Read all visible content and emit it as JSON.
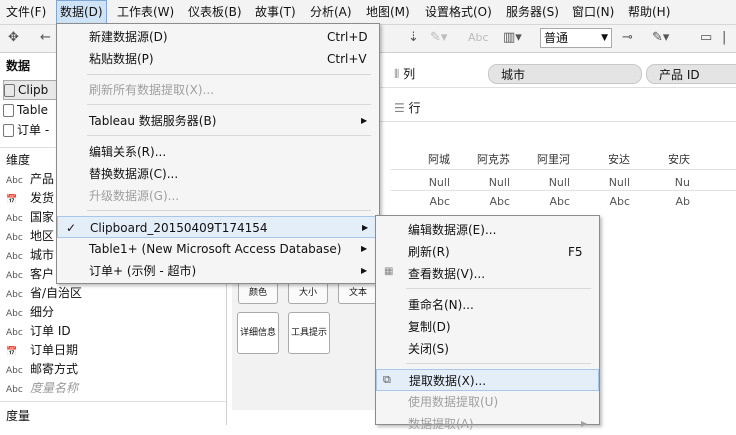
{
  "menubar": [
    "文件(F)",
    "数据(D)",
    "工作表(W)",
    "仪表板(B)",
    "故事(T)",
    "分析(A)",
    "地图(M)",
    "设置格式(O)",
    "服务器(S)",
    "窗口(N)",
    "帮助(H)"
  ],
  "toolbar": {
    "fit_value": "普通",
    "abc_label": "Abc"
  },
  "left_panel": {
    "data_title": "数据",
    "data_sources": [
      "Clipb",
      "Table",
      "订单 -"
    ],
    "dimensions_title": "维度",
    "dimensions": [
      {
        "type": "Abc",
        "name": "产品"
      },
      {
        "type": "📅",
        "name": "发货"
      },
      {
        "type": "Abc",
        "name": "国家"
      },
      {
        "type": "Abc",
        "name": "地区"
      },
      {
        "type": "Abc",
        "name": "城市"
      },
      {
        "type": "Abc",
        "name": "客户"
      },
      {
        "type": "Abc",
        "name": "省/自治区"
      },
      {
        "type": "Abc",
        "name": "细分"
      },
      {
        "type": "Abc",
        "name": "订单 ID"
      },
      {
        "type": "📅",
        "name": "订单日期"
      },
      {
        "type": "Abc",
        "name": "邮寄方式"
      },
      {
        "type": "Abc",
        "name": "度量名称"
      }
    ],
    "measures_title": "度量"
  },
  "shelves": {
    "columns_label": "列",
    "rows_label": "行",
    "column_pills": [
      "城市",
      "产品 ID"
    ]
  },
  "table": {
    "headers": [
      "阿城",
      "阿克苏",
      "阿里河",
      "安达",
      "安庆"
    ],
    "row1": [
      "Null",
      "Null",
      "Null",
      "Null",
      "Nu"
    ],
    "row2": [
      "Abc",
      "Abc",
      "Abc",
      "Abc",
      "Ab"
    ]
  },
  "marks": {
    "color": "颜色",
    "size": "大小",
    "text": "文本",
    "detail": "详细信息",
    "tooltip": "工具提示"
  },
  "data_menu": [
    {
      "label": "新建数据源(D)",
      "shortcut": "Ctrl+D",
      "disabled": false
    },
    {
      "label": "粘贴数据(P)",
      "shortcut": "Ctrl+V",
      "disabled": false
    },
    {
      "label": "刷新所有数据提取(X)...",
      "shortcut": "",
      "disabled": true
    },
    {
      "label": "Tableau 数据服务器(B)",
      "shortcut": "",
      "disabled": false,
      "submenu": true
    },
    {
      "label": "编辑关系(R)...",
      "shortcut": "",
      "disabled": false
    },
    {
      "label": "替换数据源(C)...",
      "shortcut": "",
      "disabled": false
    },
    {
      "label": "升级数据源(G)...",
      "shortcut": "",
      "disabled": true
    },
    {
      "label": "Clipboard_20150409T174154",
      "shortcut": "",
      "disabled": false,
      "submenu": true,
      "checked": true,
      "highlight": true
    },
    {
      "label": "Table1+ (New Microsoft Access Database)",
      "shortcut": "",
      "disabled": false,
      "submenu": true
    },
    {
      "label": "订单+ (示例 - 超市)",
      "shortcut": "",
      "disabled": false,
      "submenu": true
    }
  ],
  "sub_menu": [
    {
      "label": "编辑数据源(E)...",
      "shortcut": "",
      "disabled": false
    },
    {
      "label": "刷新(R)",
      "shortcut": "F5",
      "disabled": false
    },
    {
      "label": "查看数据(V)...",
      "shortcut": "",
      "disabled": false
    },
    {
      "label": "重命名(N)...",
      "shortcut": "",
      "disabled": false
    },
    {
      "label": "复制(D)",
      "shortcut": "",
      "disabled": false
    },
    {
      "label": "关闭(S)",
      "shortcut": "",
      "disabled": false
    },
    {
      "label": "提取数据(X)...",
      "shortcut": "",
      "disabled": false,
      "highlight": true
    },
    {
      "label": "使用数据提取(U)",
      "shortcut": "",
      "disabled": true
    },
    {
      "label": "数据提取(A)",
      "shortcut": "",
      "disabled": true,
      "submenu": true
    }
  ]
}
